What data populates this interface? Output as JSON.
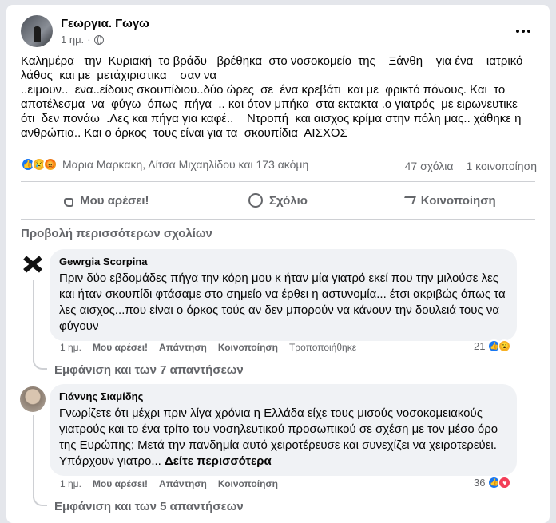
{
  "post": {
    "author": "Γεωργια. Γωγω",
    "time": "1 ημ.",
    "text": "Καλημέρα   την  Κυριακή  το βράδυ   βρέθηκα  στο νοσοκομείο  της    Ξάνθη    για ένα    ιατρικό\nλάθος  και με  μετάχιριστικα    σαν να\n..ειμουν..  ενα..είδους σκουπίδιου..δύο ώρες  σε  ένα κρεβάτι  και με  φρικτό πόνους. Και  το\nαποτέλεσμα  να  φύγω  όπως  πήγα  .. και όταν μπήκα  στα εκτακτα .ο γιατρός  με ειρωνευτικε\nότι  δεν πονάω  .Λες και πήγα για καφέ..    Ντροπή  και αισχος κρίμα στην πόλη μας.. χάθηκε η\nανθρώπια.. Και ο όρκος  τους είναι για τα  σκουπίδια  ΑΙΣΧΟΣ",
    "reactions_names": "Μαρια Μαρκακη, Λίτσα Μιχαηλίδου και 173 ακόμη",
    "comments_count": "47 σχόλια",
    "shares_count": "1 κοινοποίηση"
  },
  "actions": {
    "like": "Μου αρέσει!",
    "comment": "Σχόλιο",
    "share": "Κοινοποίηση"
  },
  "more_comments": "Προβολή περισσότερων σχολίων",
  "comments": [
    {
      "name": "Gewrgia Scorpina",
      "text": "Πριν δύο εβδομάδες πήγα την κόρη μου κ ήταν μία γιατρό εκεί που την μιλούσε λες και ήταν σκουπίδι φτάσαμε στο σημείο να έρθει η αστυνομία... έτσι ακριβώς όπως τα λες αισχος...που είναι ο όρκος τούς αν δεν μπορούν να κάνουν την δουλειά τους να φύγουν",
      "time": "1 ημ.",
      "like": "Μου αρέσει!",
      "reply": "Απάντηση",
      "share": "Κοινοποίηση",
      "edited": "Τροποποιήθηκε",
      "reaction_count": "21",
      "replies": "Εμφάνιση και των 7 απαντήσεων"
    },
    {
      "name": "Γιάννης Σιαμίδης",
      "text": "Γνωρίζετε ότι μέχρι πριν λίγα χρόνια η Ελλάδα είχε τους μισούς νοσοκομειακούς γιατρούς και το ένα τρίτο του νοσηλευτικού προσωπικού σε σχέση με τον μέσο όρο της Ευρώπης; Μετά την πανδημία αυτό χειροτέρευσε και συνεχίζει να χειροτερεύει. Υπάρχουν γιατρο...",
      "see_more": "Δείτε περισσότερα",
      "time": "1 ημ.",
      "like": "Μου αρέσει!",
      "reply": "Απάντηση",
      "share": "Κοινοποίηση",
      "reaction_count": "36",
      "replies": "Εμφάνιση και των 5 απαντήσεων"
    }
  ]
}
